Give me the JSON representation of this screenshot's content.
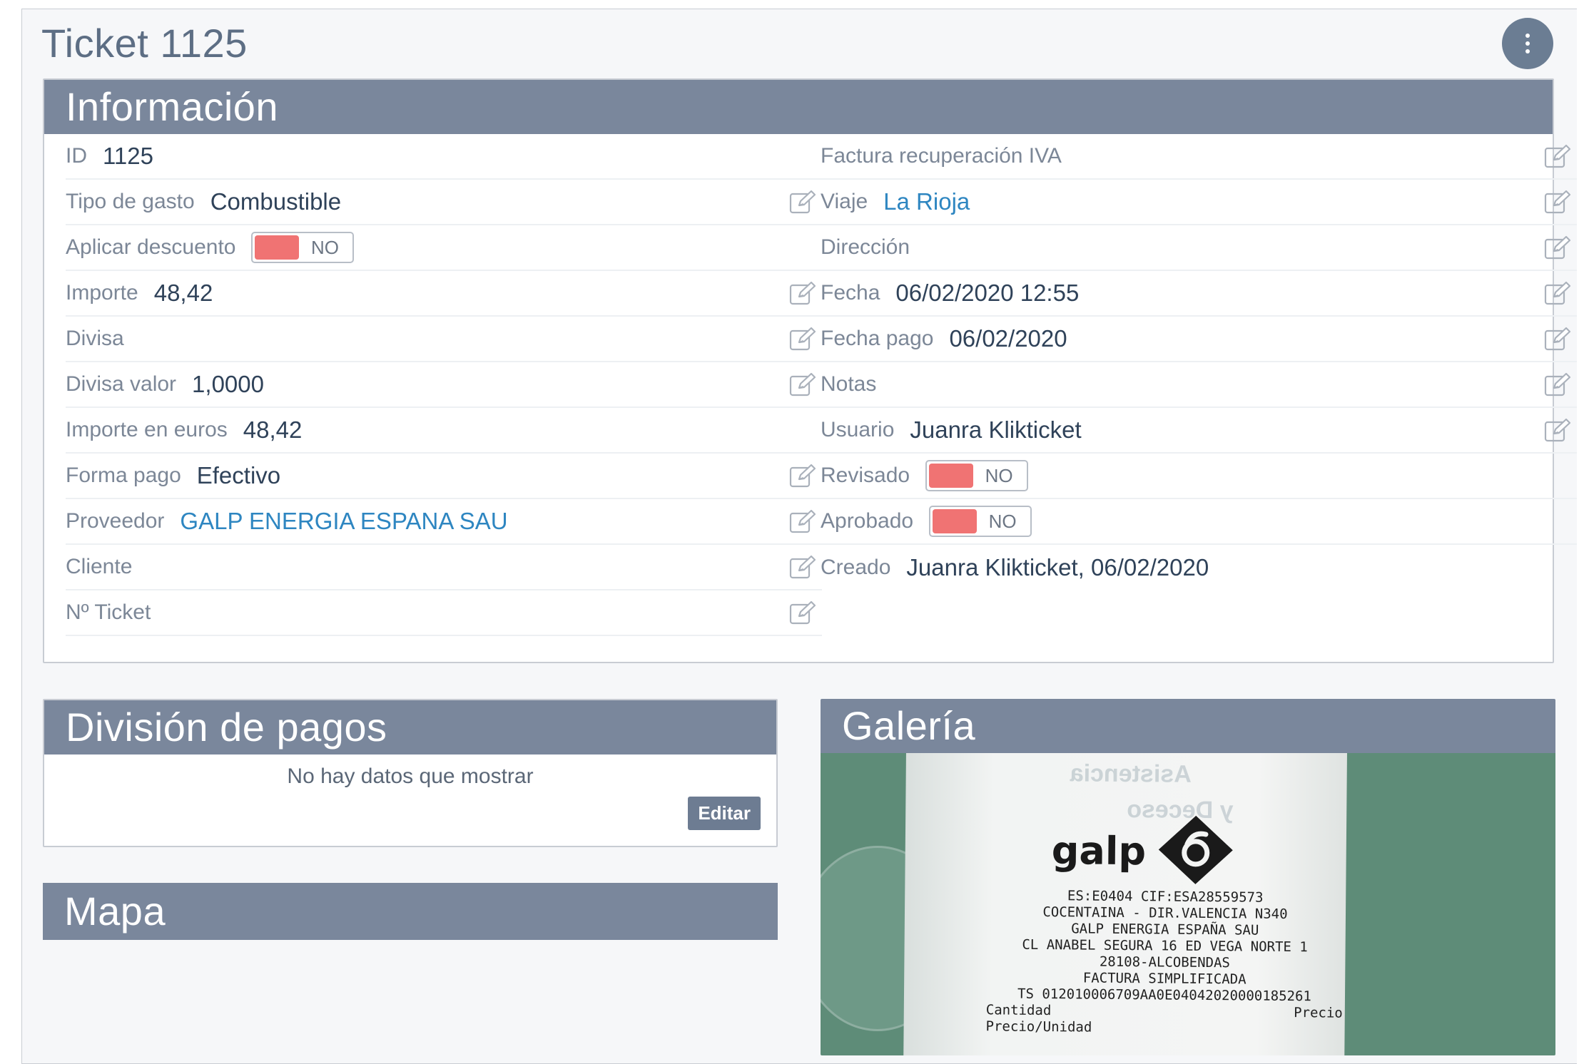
{
  "page": {
    "title": "Ticket 1125",
    "menu_icon": "vertical-ellipsis-icon"
  },
  "info": {
    "header": "Información",
    "left": [
      {
        "label": "ID",
        "value": "1125",
        "editable": false
      },
      {
        "label": "Tipo de gasto",
        "value": "Combustible",
        "editable": true
      },
      {
        "label": "Aplicar descuento",
        "toggle": "NO",
        "editable": false
      },
      {
        "label": "Importe",
        "value": "48,42",
        "editable": true
      },
      {
        "label": "Divisa",
        "value": "",
        "editable": true
      },
      {
        "label": "Divisa valor",
        "value": "1,0000",
        "editable": true
      },
      {
        "label": "Importe en euros",
        "value": "48,42",
        "editable": false
      },
      {
        "label": "Forma pago",
        "value": "Efectivo",
        "editable": true
      },
      {
        "label": "Proveedor",
        "value": "GALP ENERGIA ESPANA SAU",
        "editable": true,
        "link": true
      },
      {
        "label": "Cliente",
        "value": "",
        "editable": true
      },
      {
        "label": "Nº Ticket",
        "value": "",
        "editable": true
      }
    ],
    "right": [
      {
        "label": "Factura recuperación IVA",
        "value": "",
        "editable": true
      },
      {
        "label": "Viaje",
        "value": "La Rioja",
        "editable": true,
        "link": true
      },
      {
        "label": "Dirección",
        "value": "",
        "editable": true
      },
      {
        "label": "Fecha",
        "value": "06/02/2020 12:55",
        "editable": true
      },
      {
        "label": "Fecha pago",
        "value": "06/02/2020",
        "editable": true
      },
      {
        "label": "Notas",
        "value": "",
        "editable": true
      },
      {
        "label": "Usuario",
        "value": "Juanra Klikticket",
        "editable": true
      },
      {
        "label": "Revisado",
        "toggle": "NO",
        "editable": false
      },
      {
        "label": "Aprobado",
        "toggle": "NO",
        "editable": false
      },
      {
        "label": "Creado",
        "value": "Juanra Klikticket, 06/02/2020",
        "editable": false
      }
    ]
  },
  "pagos": {
    "header": "División de pagos",
    "empty": "No hay datos que mostrar",
    "edit_label": "Editar"
  },
  "mapa": {
    "header": "Mapa"
  },
  "galeria": {
    "header": "Galería",
    "receipt": {
      "brand": "galp",
      "lines": [
        "ES:E0404 CIF:ESA28559573",
        "COCENTAINA - DIR.VALENCIA N340",
        "GALP ENERGIA ESPAÑA SAU",
        "CL ANABEL SEGURA 16 ED VEGA NORTE 1",
        "28108-ALCOBENDAS",
        "FACTURA SIMPLIFICADA",
        "TS 012010006709AA0E04042020000185261"
      ],
      "col_left": "Cantidad",
      "col_right": "Precio",
      "last": "Precio/Unidad"
    }
  },
  "colors": {
    "header_bg": "#7a879c",
    "toggle_off": "#f07373",
    "link": "#2e86c1"
  }
}
